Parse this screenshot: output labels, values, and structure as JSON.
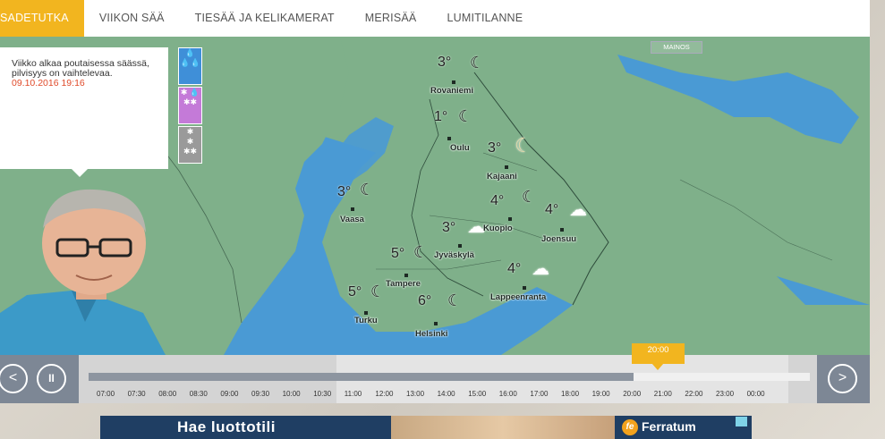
{
  "nav": {
    "tabs": [
      {
        "label": "SADETUTKA",
        "active": true
      },
      {
        "label": "VIIKON SÄÄ"
      },
      {
        "label": "TIESÄÄ JA KELIKAMERAT"
      },
      {
        "label": "MERISÄÄ"
      },
      {
        "label": "LUMITILANNE"
      }
    ]
  },
  "map": {
    "ad_label": "MAINOS",
    "cities": [
      {
        "name": "Rovaniemi",
        "temp": "3°",
        "icon": "moon-cloud-icon"
      },
      {
        "name": "Oulu",
        "temp": "1°",
        "icon": "moon-cloud-icon"
      },
      {
        "name": "Kajaani",
        "temp": "3°",
        "icon": "moon-icon"
      },
      {
        "name": "Vaasa",
        "temp": "3°",
        "icon": "moon-cloud-icon"
      },
      {
        "name": "Kuopio",
        "temp": "3°",
        "icon": "cloud-icon"
      },
      {
        "name": "Joensuu",
        "temp": "4°",
        "icon": "cloud-icon"
      },
      {
        "name": "Jyväskylä",
        "temp": "5°",
        "icon": "moon-cloud-icon"
      },
      {
        "name": "Tampere",
        "temp": "",
        "icon": ""
      },
      {
        "name": "Lappeenranta",
        "temp": "4°",
        "icon": "cloud-icon"
      },
      {
        "name": "Turku",
        "temp": "5°",
        "icon": "moon-cloud-icon"
      },
      {
        "name": "Helsinki",
        "temp": "6°",
        "icon": "moon-cloud-icon"
      },
      {
        "name": "",
        "temp": "4°",
        "icon": "moon-cloud-icon"
      }
    ]
  },
  "info": {
    "text": "Viikko alkaa poutaisessa säässä, pilvisyys on vaihtelevaa.",
    "date": "09.10.2016 19:16"
  },
  "timeline": {
    "current": "20:00",
    "times": [
      "07:00",
      "07:30",
      "08:00",
      "08:30",
      "09:00",
      "09:30",
      "10:00",
      "10:30",
      "11:00",
      "12:00",
      "13:00",
      "14:00",
      "15:00",
      "16:00",
      "17:00",
      "18:00",
      "19:00",
      "20:00",
      "21:00",
      "22:00",
      "23:00",
      "00:00"
    ],
    "prev_symbol": "<",
    "next_symbol": ">",
    "pause_symbol": "II"
  },
  "ad": {
    "title": "Hae luottotili",
    "brand": "Ferratum",
    "logo_letter": "fe"
  },
  "colors": {
    "accent": "#f2b51f",
    "sea": "#4a9ad4",
    "land": "#7fb08a",
    "timeline_dark": "#7d8795"
  }
}
